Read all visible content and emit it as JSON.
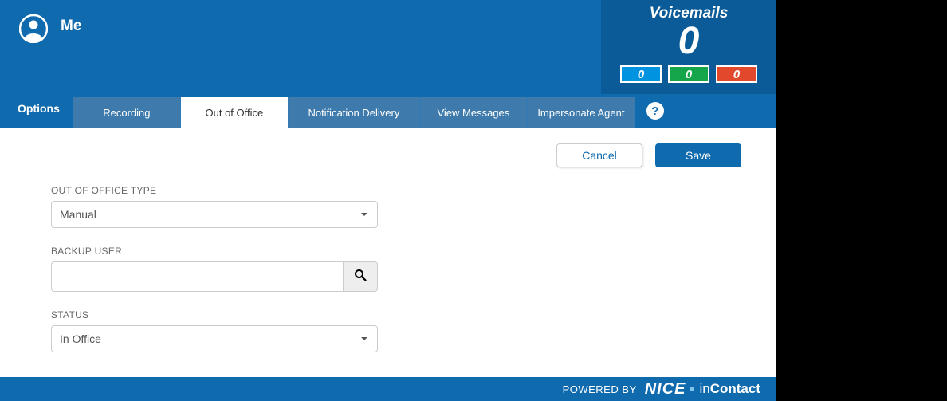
{
  "header": {
    "title": "Me",
    "voicemails_label": "Voicemails",
    "voicemails_count": "0",
    "badges": {
      "blue": "0",
      "green": "0",
      "red": "0"
    }
  },
  "tabbar": {
    "options_label": "Options",
    "tabs": {
      "recording": "Recording",
      "out_of_office": "Out of Office",
      "notification_delivery": "Notification Delivery",
      "view_messages": "View Messages",
      "impersonate_agent": "Impersonate Agent"
    },
    "help_glyph": "?"
  },
  "actions": {
    "cancel_label": "Cancel",
    "save_label": "Save"
  },
  "form": {
    "ooo_type_label": "OUT OF OFFICE TYPE",
    "ooo_type_value": "Manual",
    "backup_user_label": "BACKUP USER",
    "backup_user_value": "",
    "status_label": "STATUS",
    "status_value": "In Office"
  },
  "footer": {
    "powered_by": "POWERED BY",
    "brand_nice": "NICE",
    "brand_in": "in",
    "brand_contact": "Contact"
  }
}
